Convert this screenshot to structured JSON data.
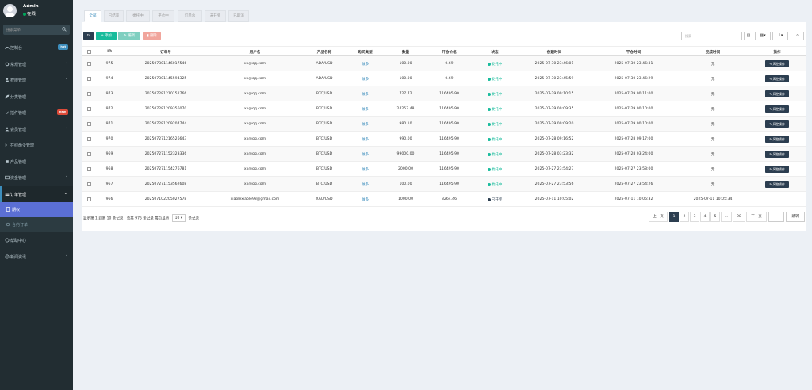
{
  "user": {
    "name": "Admin",
    "status": "在线"
  },
  "sidebar_search": {
    "placeholder": "搜索菜单"
  },
  "menu": [
    {
      "label": "控制台",
      "badge": "hot"
    },
    {
      "label": "常规管理",
      "arrow": "‹"
    },
    {
      "label": "权限管理",
      "arrow": "‹"
    },
    {
      "label": "分类管理"
    },
    {
      "label": "插件管理",
      "badge": "new"
    },
    {
      "label": "会员管理",
      "arrow": "‹"
    },
    {
      "label": "在线命令管理"
    },
    {
      "label": "产品管理"
    },
    {
      "label": "资金管理",
      "arrow": "‹"
    },
    {
      "label": "订单管理",
      "arrow": "⌄"
    }
  ],
  "submenu": [
    {
      "label": "期权"
    },
    {
      "label": "合约订单"
    }
  ],
  "menu_after": [
    {
      "label": "帮助中心"
    },
    {
      "label": "新闻资讯",
      "arrow": "‹"
    }
  ],
  "tabs": [
    "全部",
    "已结束",
    "委托中",
    "平仓中",
    "订单总",
    "未开奖",
    "已取消"
  ],
  "toolbar": {
    "add": "添加",
    "edit": "编辑",
    "delete": "删除",
    "search_placeholder": "搜索"
  },
  "columns": [
    "ID",
    "订单号",
    "用户名",
    "产品名称",
    "购买类型",
    "数量",
    "开仓价格",
    "状态",
    "创建时间",
    "平仓时间",
    "完成时间",
    "操作"
  ],
  "rows": [
    {
      "id": "975",
      "order": "20250730114601754​6",
      "user": "xx@qq.com",
      "product": "ADA/USD",
      "dir": "做多",
      "qty": "100.00",
      "price": "0.69",
      "status": "委托中",
      "status_color": "green",
      "created": "2025-07-30 23:46:01",
      "closed": "2025-07-30 23:46:31",
      "done": "无",
      "op": "风控操作"
    },
    {
      "id": "974",
      "order": "20250730114559432​5",
      "user": "xx@qq.com",
      "product": "ADA/USD",
      "dir": "做多",
      "qty": "100.00",
      "price": "0.69",
      "status": "委托中",
      "status_color": "green",
      "created": "2025-07-30 23:45:59",
      "closed": "2025-07-30 23:46:29",
      "done": "无",
      "op": "风控操作"
    },
    {
      "id": "973",
      "order": "20250728121015276​6",
      "user": "xx@qq.com",
      "product": "BTC/USD",
      "dir": "做多",
      "qty": "727.72",
      "price": "116495.90",
      "status": "委托中",
      "status_color": "green",
      "created": "2025-07-29 00:10:15",
      "closed": "2025-07-29 00:11:00",
      "done": "无",
      "op": "风控操作"
    },
    {
      "id": "972",
      "order": "20250728120935607​0",
      "user": "xx@qq.com",
      "product": "BTC/USD",
      "dir": "做多",
      "qty": "24257.48",
      "price": "116495.90",
      "status": "委托中",
      "status_color": "green",
      "created": "2025-07-29 00:09:35",
      "closed": "2025-07-29 00:10:00",
      "done": "无",
      "op": "风控操作"
    },
    {
      "id": "971",
      "order": "20250728120920474​4",
      "user": "xx@qq.com",
      "product": "BTC/USD",
      "dir": "做多",
      "qty": "980.10",
      "price": "116495.90",
      "status": "委托中",
      "status_color": "green",
      "created": "2025-07-29 00:09:20",
      "closed": "2025-07-29 00:10:00",
      "done": "无",
      "op": "风控操作"
    },
    {
      "id": "970",
      "order": "20250727121652664​3",
      "user": "xx@qq.com",
      "product": "BTC/USD",
      "dir": "做多",
      "qty": "990.00",
      "price": "116495.90",
      "status": "委托中",
      "status_color": "green",
      "created": "2025-07-28 09:16:52",
      "closed": "2025-07-28 09:17:00",
      "done": "无",
      "op": "风控操作"
    },
    {
      "id": "969",
      "order": "20250727115232333​6",
      "user": "xx@qq.com",
      "product": "BTC/USD",
      "dir": "做多",
      "qty": "99000.00",
      "price": "116495.90",
      "status": "委托中",
      "status_color": "green",
      "created": "2025-07-28 03:23:32",
      "closed": "2025-07-28 03:24:00",
      "done": "无",
      "op": "风控操作"
    },
    {
      "id": "968",
      "order": "20250727115427678​1",
      "user": "xx@qq.com",
      "product": "BTC/USD",
      "dir": "做多",
      "qty": "2000.00",
      "price": "116495.90",
      "status": "委托中",
      "status_color": "green",
      "created": "2025-07-27 23:54:27",
      "closed": "2025-07-27 23:58:00",
      "done": "无",
      "op": "风控操作"
    },
    {
      "id": "967",
      "order": "20250727115356260​8",
      "user": "xx@qq.com",
      "product": "BTC/USD",
      "dir": "做多",
      "qty": "100.00",
      "price": "116495.90",
      "status": "委托中",
      "status_color": "green",
      "created": "2025-07-27 23:53:56",
      "closed": "2025-07-27 23:54:26",
      "done": "无",
      "op": "风控操作"
    },
    {
      "id": "966",
      "order": "20250710220502757​8",
      "user": "xiaolexiaole93@gmail.com",
      "product": "XAU/USD",
      "dir": "做多",
      "qty": "1000.00",
      "price": "3264.46",
      "status": "已开奖",
      "status_color": "dark",
      "created": "2025-07-11 10:05:02",
      "closed": "2025-07-11 10:05:32",
      "done": "2025-07-11 10:05:34",
      "op": ""
    }
  ],
  "footer": {
    "prefix": "显示第 1 到第 10 条记录，总共 975 条记录 每页显示",
    "page_size": "10",
    "suffix": "条记录"
  },
  "pagination": {
    "prev": "上一页",
    "pages": [
      "1",
      "2",
      "3",
      "4",
      "5",
      "...",
      "98"
    ],
    "next": "下一页",
    "jump": "跳转"
  },
  "colors": {
    "sidebar_bg": "#222d32",
    "accent": "#18bc9c",
    "dark": "#2c3e50",
    "active_sub": "#5b6fd4"
  }
}
